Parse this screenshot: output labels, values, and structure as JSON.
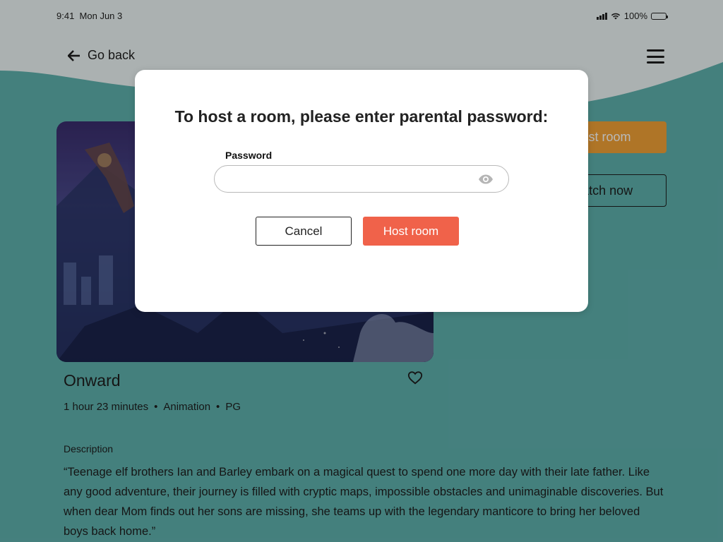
{
  "status_bar": {
    "time": "9:41",
    "date": "Mon Jun 3",
    "battery_percent": "100%"
  },
  "nav": {
    "back_label": "Go back",
    "back_icon": "arrow-left-icon",
    "menu_icon": "hamburger-menu-icon"
  },
  "movie": {
    "title": "Onward",
    "duration": "1 hour 23 minutes",
    "genre": "Animation",
    "rating": "PG",
    "separator": "•",
    "description_label": "Description",
    "description": "“Teenage elf brothers Ian and Barley embark on a magical quest to spend one more day with their late father. Like any good adventure, their journey is filled with cryptic maps, impossible obstacles and unimaginable discoveries. But when dear Mom finds out her sons are missing, she teams up with the legendary manticore to bring her beloved boys back home.”",
    "favorite_icon": "heart-icon"
  },
  "actions": {
    "host_room_label": "Host room",
    "watch_now_label": "Watch now"
  },
  "modal": {
    "title": "To host a room, please enter parental password:",
    "password_label": "Password",
    "password_value": "",
    "password_placeholder": "",
    "eye_icon": "eye-icon",
    "cancel_label": "Cancel",
    "confirm_label": "Host room"
  },
  "colors": {
    "background": "#5fb2ae",
    "host_room_accent": "#f3a236",
    "modal_confirm": "#f0624a"
  }
}
